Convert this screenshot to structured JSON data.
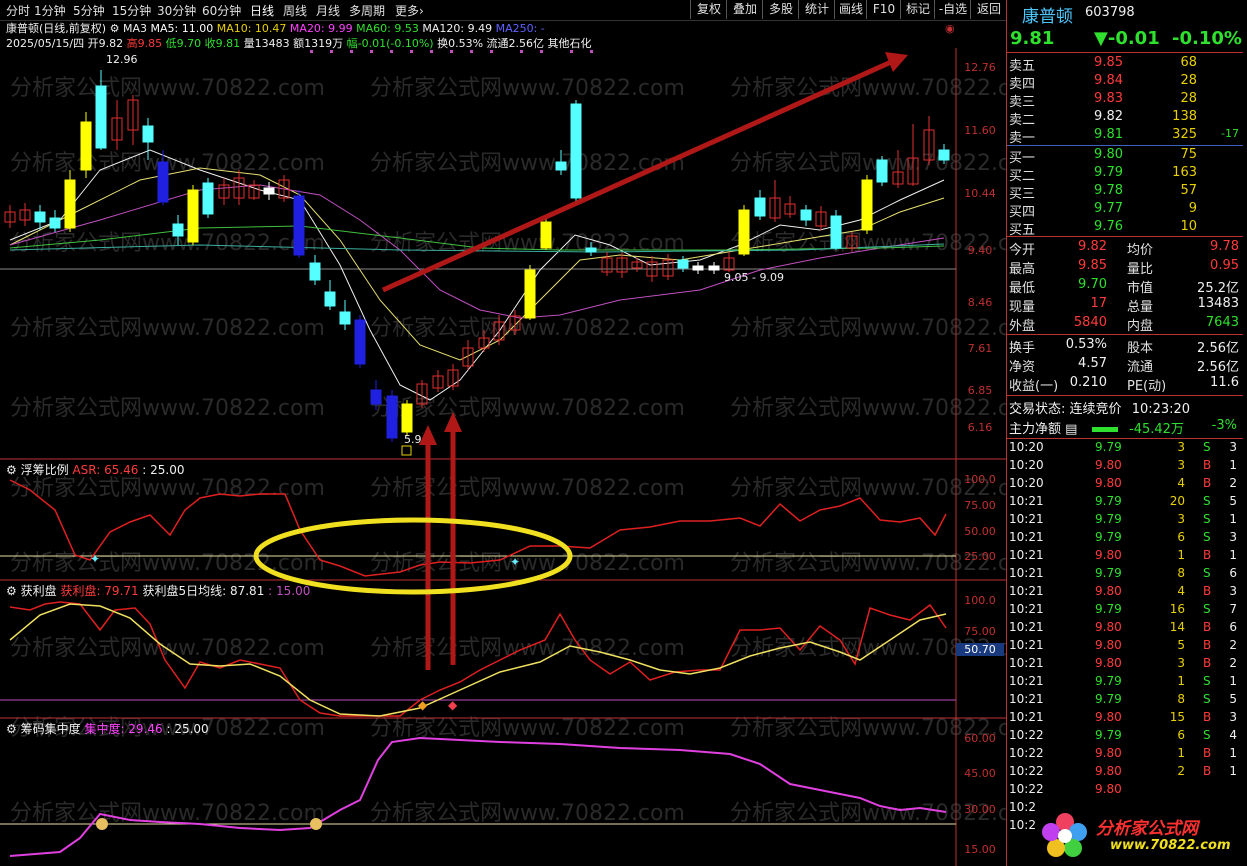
{
  "toolbar": {
    "periods": [
      "分时",
      "1分钟",
      "5分钟",
      "15分钟",
      "30分钟",
      "60分钟",
      "日线",
      "周线",
      "月线",
      "多周期",
      "更多›"
    ],
    "buttons": [
      "复权",
      "叠加",
      "多股",
      "统计",
      "画线",
      "F10",
      "标记",
      "-自选",
      "返回"
    ]
  },
  "info": {
    "title": "康普顿(日线,前复权)",
    "ma_label": "MA3",
    "ma5": "MA5: 11.00",
    "ma10": "MA10: 10.47",
    "ma20": "MA20: 9.99",
    "ma60": "MA60: 9.53",
    "ma120": "MA120: 9.49",
    "ma250": "MA250: -",
    "date_open": "2025/05/15/四 开9.82",
    "high": "高9.85",
    "low": "低9.70",
    "close": "收9.81",
    "vol": "量13483",
    "amt": "额1319万",
    "change": "幅-0.01(-0.10%)",
    "turnover": "换0.53%",
    "float": "流通2.56亿",
    "sector": "其他石化"
  },
  "annotations": {
    "max_label": "12.96",
    "min_label": "5.9",
    "range_label": "9.05 - 9.09",
    "right_marker": "50.70"
  },
  "price_axis": [
    "12.76",
    "11.60",
    "10.44",
    "9.40",
    "8.46",
    "7.61",
    "6.85",
    "6.16"
  ],
  "panel_asr": {
    "name": "浮筹比例",
    "line": "ASR: 65.46",
    "ref": ": 25.00",
    "axis": [
      "100.0",
      "75.00",
      "50.00",
      "25.00"
    ]
  },
  "panel_profit": {
    "name": "获利盘",
    "line1": "获利盘: 79.71",
    "line2": "获利盘5日均线: 87.81",
    "ref": ": 15.00",
    "axis": [
      "100.0",
      "75.00"
    ]
  },
  "panel_conc": {
    "name": "筹码集中度",
    "line": "集中度: 29.46",
    "ref": ": 25.00",
    "axis": [
      "60.00",
      "45.00",
      "30.00",
      "15.00"
    ]
  },
  "stock": {
    "name": "康普顿",
    "code": "603798",
    "price": "9.81",
    "change": "▼-0.01",
    "pct": "-0.10%"
  },
  "asks": [
    {
      "label": "卖五",
      "price": "9.85",
      "vol": "68",
      "chg": ""
    },
    {
      "label": "卖四",
      "price": "9.84",
      "vol": "28",
      "chg": ""
    },
    {
      "label": "卖三",
      "price": "9.83",
      "vol": "28",
      "chg": ""
    },
    {
      "label": "卖二",
      "price": "9.82",
      "vol": "138",
      "chg": ""
    },
    {
      "label": "卖一",
      "price": "9.81",
      "vol": "325",
      "chg": "-17"
    }
  ],
  "bids": [
    {
      "label": "买一",
      "price": "9.80",
      "vol": "75"
    },
    {
      "label": "买二",
      "price": "9.79",
      "vol": "163"
    },
    {
      "label": "买三",
      "price": "9.78",
      "vol": "57"
    },
    {
      "label": "买四",
      "price": "9.77",
      "vol": "9"
    },
    {
      "label": "买五",
      "price": "9.76",
      "vol": "10"
    }
  ],
  "stats": [
    {
      "l1": "今开",
      "v1": "9.82",
      "l2": "均价",
      "v2": "9.78"
    },
    {
      "l1": "最高",
      "v1": "9.85",
      "l2": "量比",
      "v2": "0.95"
    },
    {
      "l1": "最低",
      "v1": "9.70",
      "l2": "市值",
      "v2": "25.2亿"
    },
    {
      "l1": "现量",
      "v1": "17",
      "l2": "总量",
      "v2": "13483"
    },
    {
      "l1": "外盘",
      "v1": "5840",
      "l2": "内盘",
      "v2": "7643"
    }
  ],
  "stats2": [
    {
      "l1": "换手",
      "v1": "0.53%",
      "l2": "股本",
      "v2": "2.56亿"
    },
    {
      "l1": "净资",
      "v1": "4.57",
      "l2": "流通",
      "v2": "2.56亿"
    },
    {
      "l1": "收益(一)",
      "v1": "0.210",
      "l2": "PE(动)",
      "v2": "11.6"
    }
  ],
  "trade_state": {
    "label": "交易状态:",
    "value": "连续竞价",
    "time": "10:23:20"
  },
  "main_flow": {
    "label": "主力净额",
    "value": "-45.42万",
    "pct": "-3%"
  },
  "ticks": [
    {
      "t": "10:20",
      "p": "9.79",
      "v": "3",
      "s": "S",
      "n": "3"
    },
    {
      "t": "10:20",
      "p": "9.80",
      "v": "3",
      "s": "B",
      "n": "1"
    },
    {
      "t": "10:20",
      "p": "9.80",
      "v": "4",
      "s": "B",
      "n": "2"
    },
    {
      "t": "10:21",
      "p": "9.79",
      "v": "20",
      "s": "S",
      "n": "5"
    },
    {
      "t": "10:21",
      "p": "9.79",
      "v": "3",
      "s": "S",
      "n": "1"
    },
    {
      "t": "10:21",
      "p": "9.79",
      "v": "6",
      "s": "S",
      "n": "3"
    },
    {
      "t": "10:21",
      "p": "9.80",
      "v": "1",
      "s": "B",
      "n": "1"
    },
    {
      "t": "10:21",
      "p": "9.79",
      "v": "8",
      "s": "S",
      "n": "6"
    },
    {
      "t": "10:21",
      "p": "9.80",
      "v": "4",
      "s": "B",
      "n": "3"
    },
    {
      "t": "10:21",
      "p": "9.79",
      "v": "16",
      "s": "S",
      "n": "7"
    },
    {
      "t": "10:21",
      "p": "9.80",
      "v": "14",
      "s": "B",
      "n": "6"
    },
    {
      "t": "10:21",
      "p": "9.80",
      "v": "5",
      "s": "B",
      "n": "2"
    },
    {
      "t": "10:21",
      "p": "9.80",
      "v": "3",
      "s": "B",
      "n": "2"
    },
    {
      "t": "10:21",
      "p": "9.79",
      "v": "1",
      "s": "S",
      "n": "1"
    },
    {
      "t": "10:21",
      "p": "9.79",
      "v": "8",
      "s": "S",
      "n": "5"
    },
    {
      "t": "10:21",
      "p": "9.80",
      "v": "15",
      "s": "B",
      "n": "3"
    },
    {
      "t": "10:22",
      "p": "9.79",
      "v": "6",
      "s": "S",
      "n": "4"
    },
    {
      "t": "10:22",
      "p": "9.80",
      "v": "1",
      "s": "B",
      "n": "1"
    },
    {
      "t": "10:22",
      "p": "9.80",
      "v": "2",
      "s": "B",
      "n": "1"
    },
    {
      "t": "10:22",
      "p": "9.80",
      "v": "",
      "s": "",
      "n": ""
    },
    {
      "t": "10:2",
      "p": "",
      "v": "",
      "s": "",
      "n": ""
    },
    {
      "t": "10:2",
      "p": "",
      "v": "",
      "s": "",
      "n": ""
    }
  ],
  "watermark": "分析家公式网www.70822.com",
  "logo": {
    "text": "分析家公式网",
    "url": "www.70822.com"
  }
}
